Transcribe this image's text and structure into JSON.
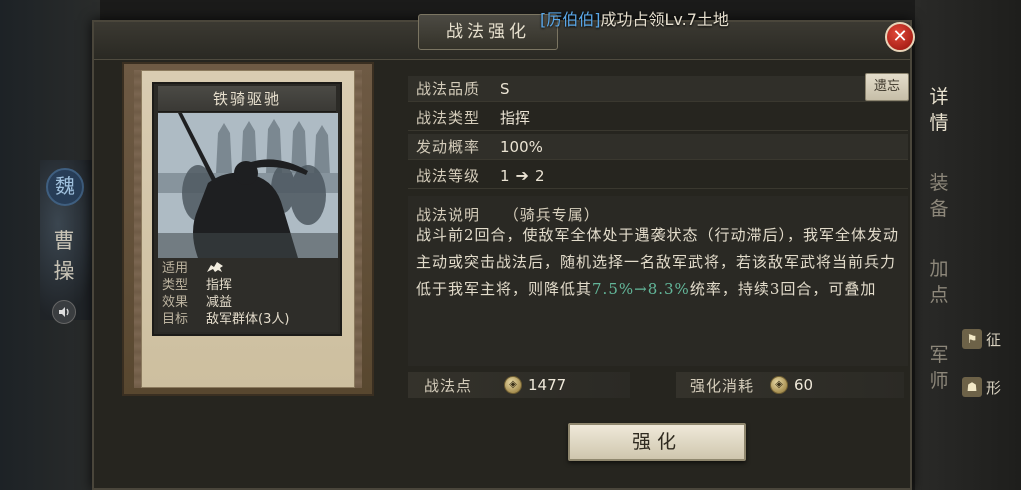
{
  "broadcast": {
    "player": "[厉伯伯]",
    "message": "成功占领Lv.7土地"
  },
  "dialog": {
    "title": "战法强化",
    "close_label": "✕"
  },
  "left_panel": {
    "seal": "魏",
    "name": "曹操",
    "sound_icon": "speaker-icon"
  },
  "right_tabs": [
    {
      "label": "详情",
      "active": true
    },
    {
      "label": "装备",
      "active": false
    },
    {
      "label": "加点",
      "active": false
    },
    {
      "label": "军师",
      "active": false
    }
  ],
  "right_actions": [
    {
      "icon": "flag-icon",
      "label": "征"
    },
    {
      "icon": "person-icon",
      "label": "形"
    }
  ],
  "card": {
    "name": "铁骑驱驰",
    "rows": [
      {
        "key": "适用",
        "value": "",
        "icon": "cavalry-icon"
      },
      {
        "key": "类型",
        "value": "指挥"
      },
      {
        "key": "效果",
        "value": "减益"
      },
      {
        "key": "目标",
        "value": "敌军群体(3人)"
      }
    ]
  },
  "info": {
    "quality": {
      "label": "战法品质",
      "value": "S"
    },
    "type": {
      "label": "战法类型",
      "value": "指挥"
    },
    "chance": {
      "label": "发动概率",
      "value": "100%"
    },
    "level": {
      "label": "战法等级",
      "from": "1",
      "arrow": "➔",
      "to": "2"
    },
    "forget_label": "遗忘"
  },
  "description": {
    "label": "战法说明",
    "tag": "（骑兵专属）",
    "text_before": "战斗前2回合，使敌军全体处于遇袭状态（行动滞后），我军全体发动主动或突击战法后，随机选择一名敌军武将，若该敌军武将当前兵力低于我军主将，则降低其",
    "highlight": "7.5%→8.3%",
    "text_after": "统率，持续3回合，可叠加"
  },
  "resources": {
    "points_label": "战法点",
    "points_value": "1477",
    "cost_label": "强化消耗",
    "cost_value": "60"
  },
  "enhance_button": "强化",
  "colors": {
    "level_target": "#7ac75f",
    "highlight": "#63b79a",
    "player_name": "#5aa7e8",
    "close": "#c8281c"
  }
}
